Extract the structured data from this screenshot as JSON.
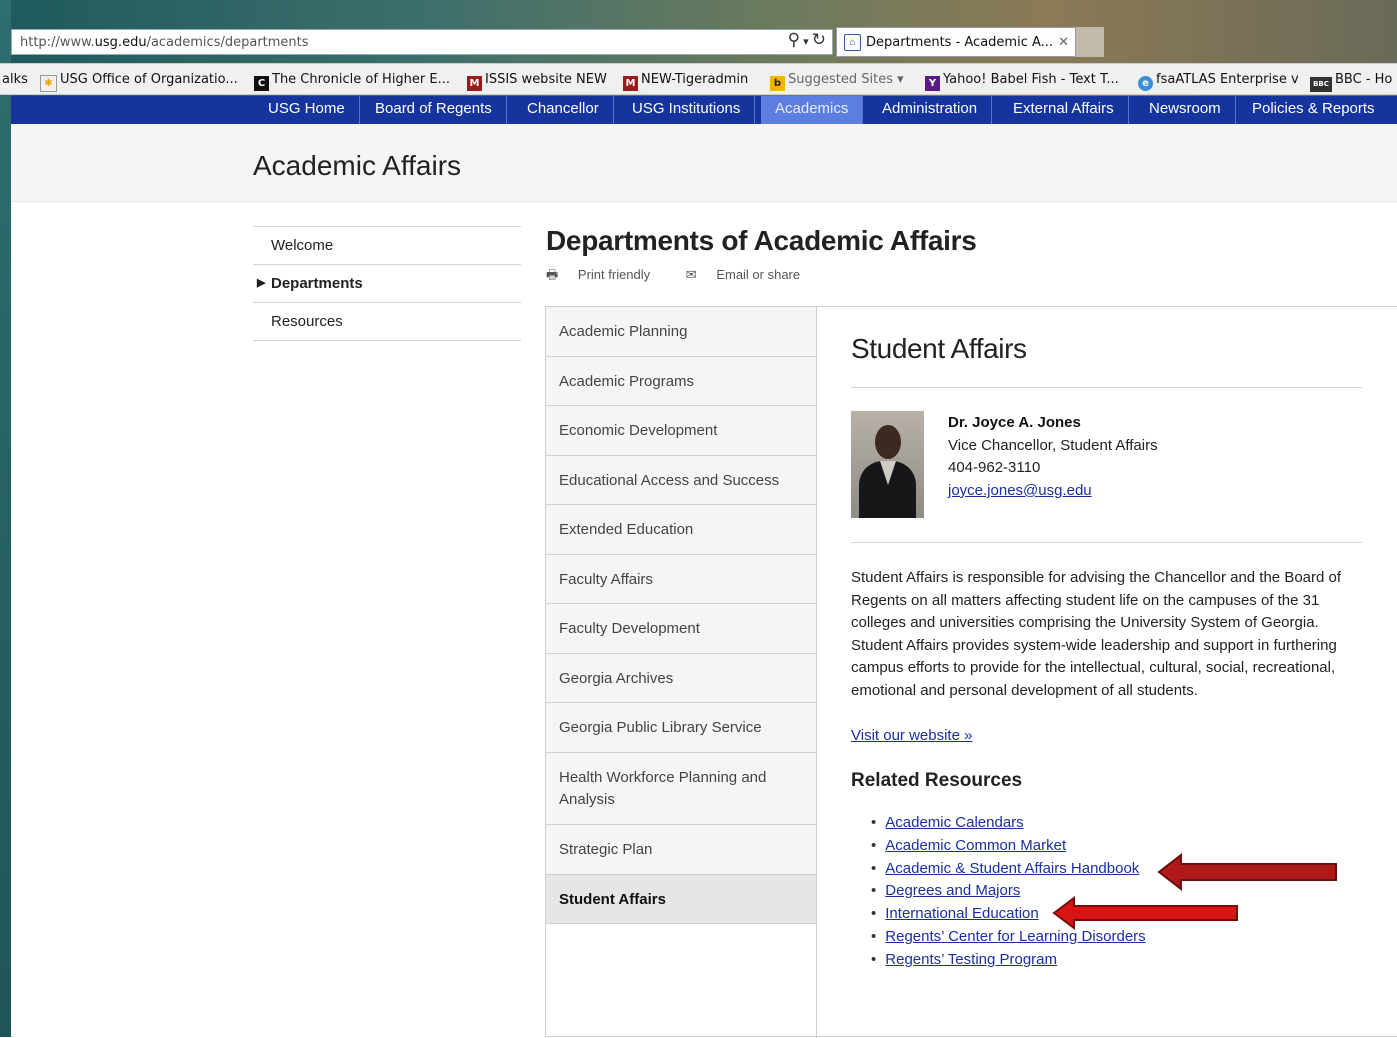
{
  "browser": {
    "url_prefix": "http://www.",
    "url_domain": "usg.edu",
    "url_path": "/academics/departments",
    "tab_title": "Departments - Academic A...",
    "favorites": [
      {
        "label": "alks",
        "icon": ""
      },
      {
        "label": "USG Office of Organizatio...",
        "icon": "usg-star-icon"
      },
      {
        "label": "The Chronicle of Higher E...",
        "icon": "chronicle-icon"
      },
      {
        "label": "ISSIS website NEW",
        "icon": "university-logo-icon"
      },
      {
        "label": "NEW-Tigeradmin",
        "icon": "university-logo-icon"
      },
      {
        "label": "Suggested Sites ▾",
        "icon": "bing-icon"
      },
      {
        "label": "Yahoo! Babel Fish - Text T...",
        "icon": "yahoo-icon"
      },
      {
        "label": "fsaATLAS Enterprise v",
        "icon": "ie-icon"
      },
      {
        "label": "BBC - Ho",
        "icon": "bbc-icon"
      }
    ]
  },
  "nav": {
    "items": [
      "USG Home",
      "Board of Regents",
      "Chancellor",
      "USG Institutions",
      "Academics",
      "Administration",
      "External Affairs",
      "Newsroom",
      "Policies & Reports"
    ],
    "active": "Academics"
  },
  "banner": {
    "title": "Academic Affairs"
  },
  "sidebar": {
    "items": [
      {
        "label": "Welcome"
      },
      {
        "label": "Departments"
      },
      {
        "label": "Resources"
      }
    ],
    "current": "Departments"
  },
  "page": {
    "title": "Departments of Academic Affairs",
    "print_label": "Print friendly",
    "email_label": "Email or share"
  },
  "departments": [
    "Academic Planning",
    "Academic Programs",
    "Economic Development",
    "Educational Access and Success",
    "Extended Education",
    "Faculty Affairs",
    "Faculty Development",
    "Georgia Archives",
    "Georgia Public Library Service",
    "Health Workforce Planning and Analysis",
    "Strategic Plan",
    "Student Affairs"
  ],
  "selected_department": "Student Affairs",
  "content": {
    "heading": "Student Affairs",
    "person": {
      "name": "Dr. Joyce A. Jones",
      "role": "Vice Chancellor, Student Affairs",
      "phone": "404-962-3110",
      "email": "joyce.jones@usg.edu"
    },
    "description": "Student Affairs is responsible for advising the Chancellor and the Board of Regents on all matters affecting student life on the campuses of the 31 colleges and universities comprising the University System of Georgia. Student Affairs provides system-wide leadership and support in furthering campus efforts to provide for the intellectual, cultural, social, recreational, emotional and personal development of all students.",
    "visit_link": "Visit our website »",
    "related_heading": "Related Resources",
    "related": [
      "Academic Calendars",
      "Academic Common Market",
      "Academic & Student Affairs Handbook",
      "Degrees and Majors",
      "International Education",
      "Regents’ Center for Learning Disorders",
      "Regents’ Testing Program"
    ]
  },
  "colors": {
    "nav": "#15349e",
    "nav_active": "#5c7ee0",
    "link": "#1a2fa0",
    "arrow": "#b01919"
  }
}
